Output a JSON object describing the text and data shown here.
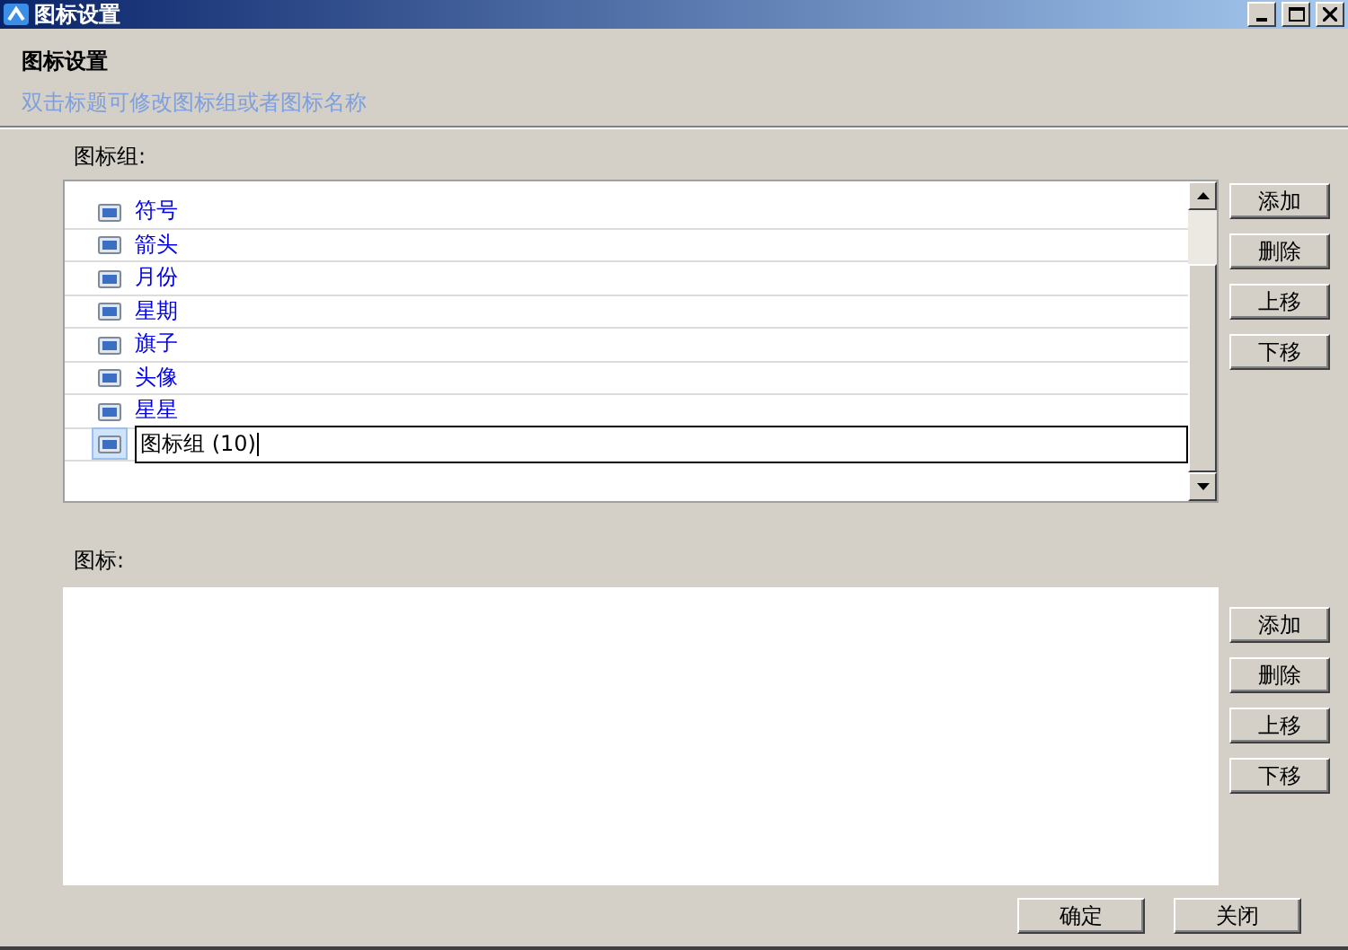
{
  "window": {
    "title": "图标设置"
  },
  "header": {
    "title": "图标设置",
    "hint": "双击标题可修改图标组或者图标名称"
  },
  "groups": {
    "label": "图标组:",
    "items": [
      {
        "name": "符号",
        "editing": false
      },
      {
        "name": "箭头",
        "editing": false
      },
      {
        "name": "月份",
        "editing": false
      },
      {
        "name": "星期",
        "editing": false
      },
      {
        "name": "旗子",
        "editing": false
      },
      {
        "name": "头像",
        "editing": false
      },
      {
        "name": "星星",
        "editing": false
      },
      {
        "name": "图标组 (10)",
        "editing": true
      }
    ],
    "buttons": [
      "添加",
      "删除",
      "上移",
      "下移"
    ]
  },
  "icons": {
    "label": "图标:",
    "buttons": [
      "添加",
      "删除",
      "上移",
      "下移"
    ]
  },
  "footer": {
    "buttons": [
      "确定",
      "关闭"
    ]
  }
}
